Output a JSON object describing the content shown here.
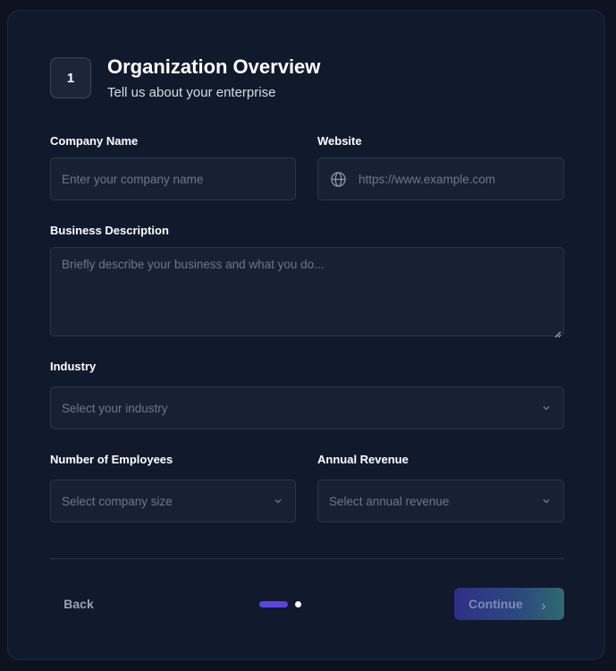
{
  "header": {
    "step_number": "1",
    "title": "Organization Overview",
    "subtitle": "Tell us about your enterprise"
  },
  "form": {
    "company_name": {
      "label": "Company Name",
      "placeholder": "Enter your company name",
      "value": ""
    },
    "website": {
      "label": "Website",
      "placeholder": "https://www.example.com",
      "value": "",
      "icon": "globe-icon"
    },
    "business_description": {
      "label": "Business Description",
      "placeholder": "Briefly describe your business and what you do...",
      "value": ""
    },
    "industry": {
      "label": "Industry",
      "selected": "Select your industry",
      "icon": "chevron-down-icon"
    },
    "employees": {
      "label": "Number of Employees",
      "selected": "Select company size",
      "icon": "chevron-down-icon"
    },
    "revenue": {
      "label": "Annual Revenue",
      "selected": "Select annual revenue",
      "icon": "chevron-down-icon"
    }
  },
  "footer": {
    "back_label": "Back",
    "continue_label": "Continue",
    "continue_icon": "chevron-right-icon",
    "step_indicator": {
      "current": 1,
      "total": 2
    }
  },
  "colors": {
    "background": "#0c1220",
    "card": "#111a2c",
    "field": "#172133",
    "border": "#2b3649",
    "accent": "#5b45e0",
    "text": "#ffffff",
    "placeholder": "#6d788b"
  }
}
